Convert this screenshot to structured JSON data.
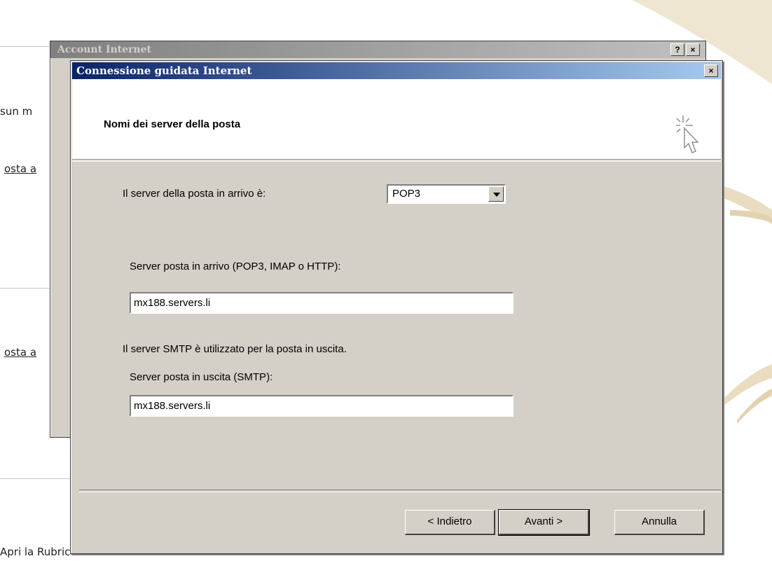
{
  "background_page": {
    "fragment_1": "sun m",
    "fragment_2": "osta a",
    "fragment_3": "osta a",
    "fragment_4": "Apri la Rubrica..."
  },
  "back_dialog": {
    "title": "Account Internet",
    "help_button": "?",
    "close_button": "×"
  },
  "wizard": {
    "title": "Connessione guidata Internet",
    "close_button": "×",
    "heading": "Nomi dei server della posta",
    "incoming_type_label": "Il server della posta in arrivo è:",
    "incoming_type_value": "POP3",
    "incoming_server_label": "Server posta in arrivo (POP3, IMAP o HTTP):",
    "incoming_server_value": "mx188.servers.li",
    "smtp_info": "Il server SMTP è utilizzato per la posta in uscita.",
    "outgoing_server_label": "Server posta in uscita (SMTP):",
    "outgoing_server_value": "mx188.servers.li",
    "back_button": "< Indietro",
    "next_button": "Avanti >",
    "cancel_button": "Annulla"
  },
  "icons": {
    "header_icon": "wizard-cursor-sparkle-icon"
  }
}
